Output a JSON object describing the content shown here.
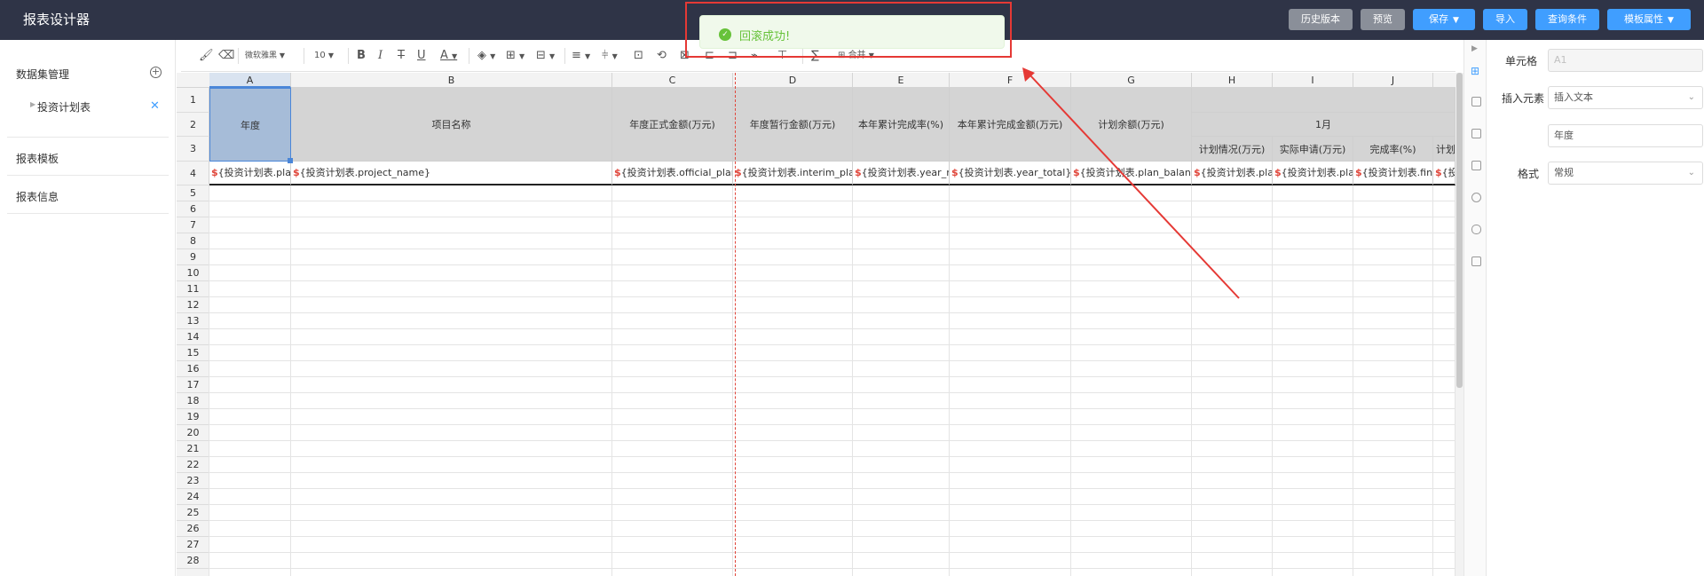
{
  "app": {
    "title": "报表设计器"
  },
  "topbar": {
    "history": "历史版本",
    "preview": "预览",
    "save": "保存",
    "import": "导入",
    "query": "查询条件",
    "template_props": "模板属性"
  },
  "sidebar": {
    "dataset_title": "数据集管理",
    "dataset_item": "投资计划表",
    "template_title": "报表模板",
    "info_title": "报表信息"
  },
  "toolbar": {
    "font": "微软雅黑",
    "size": "10",
    "merge": "合并"
  },
  "sheet": {
    "columns": [
      "A",
      "B",
      "C",
      "D",
      "E",
      "F",
      "G",
      "H",
      "I",
      "J"
    ],
    "rows": [
      "1",
      "2",
      "3",
      "4",
      "5",
      "6",
      "7",
      "8",
      "9",
      "10",
      "11",
      "12",
      "13",
      "14",
      "15",
      "16",
      "17",
      "18",
      "19",
      "20",
      "21",
      "22",
      "23",
      "24",
      "25",
      "26",
      "27",
      "28"
    ],
    "headers": {
      "year": "年度",
      "project": "项目名称",
      "official": "年度正式金额(万元)",
      "interim": "年度暂行金额(万元)",
      "rate": "本年累计完成率(%)",
      "total": "本年累计完成金额(万元)",
      "balance": "计划余额(万元)",
      "month": "1月",
      "plan": "计划情况(万元)",
      "actual": "实际申请(万元)",
      "finish": "完成率(%)",
      "partial": "计划"
    },
    "row4": {
      "a": "${投资计划表.plan_year}",
      "b": "${投资计划表.project_name}",
      "c": "${投资计划表.official_plan}",
      "d": "${投资计划表.interim_plan}",
      "e": "${投资计划表.year_rate}",
      "f": "${投资计划表.year_total}",
      "g": "${投资计划表.plan_balance}",
      "h": "${投资计划表.plan}",
      "i": "${投资计划表.plan}",
      "j": "${投资计划表.finish}",
      "k": "${投资"
    }
  },
  "panel": {
    "cell_label": "单元格",
    "cell_value": "A1",
    "insert_label": "插入元素",
    "insert_value": "插入文本",
    "text_value": "年度",
    "format_label": "格式",
    "format_value": "常规"
  },
  "toast": {
    "message": "回滚成功!"
  },
  "colors": {
    "topbar": "#2f3447",
    "accent": "#409eff",
    "success": "#67c23a",
    "annotation": "#e53935"
  }
}
